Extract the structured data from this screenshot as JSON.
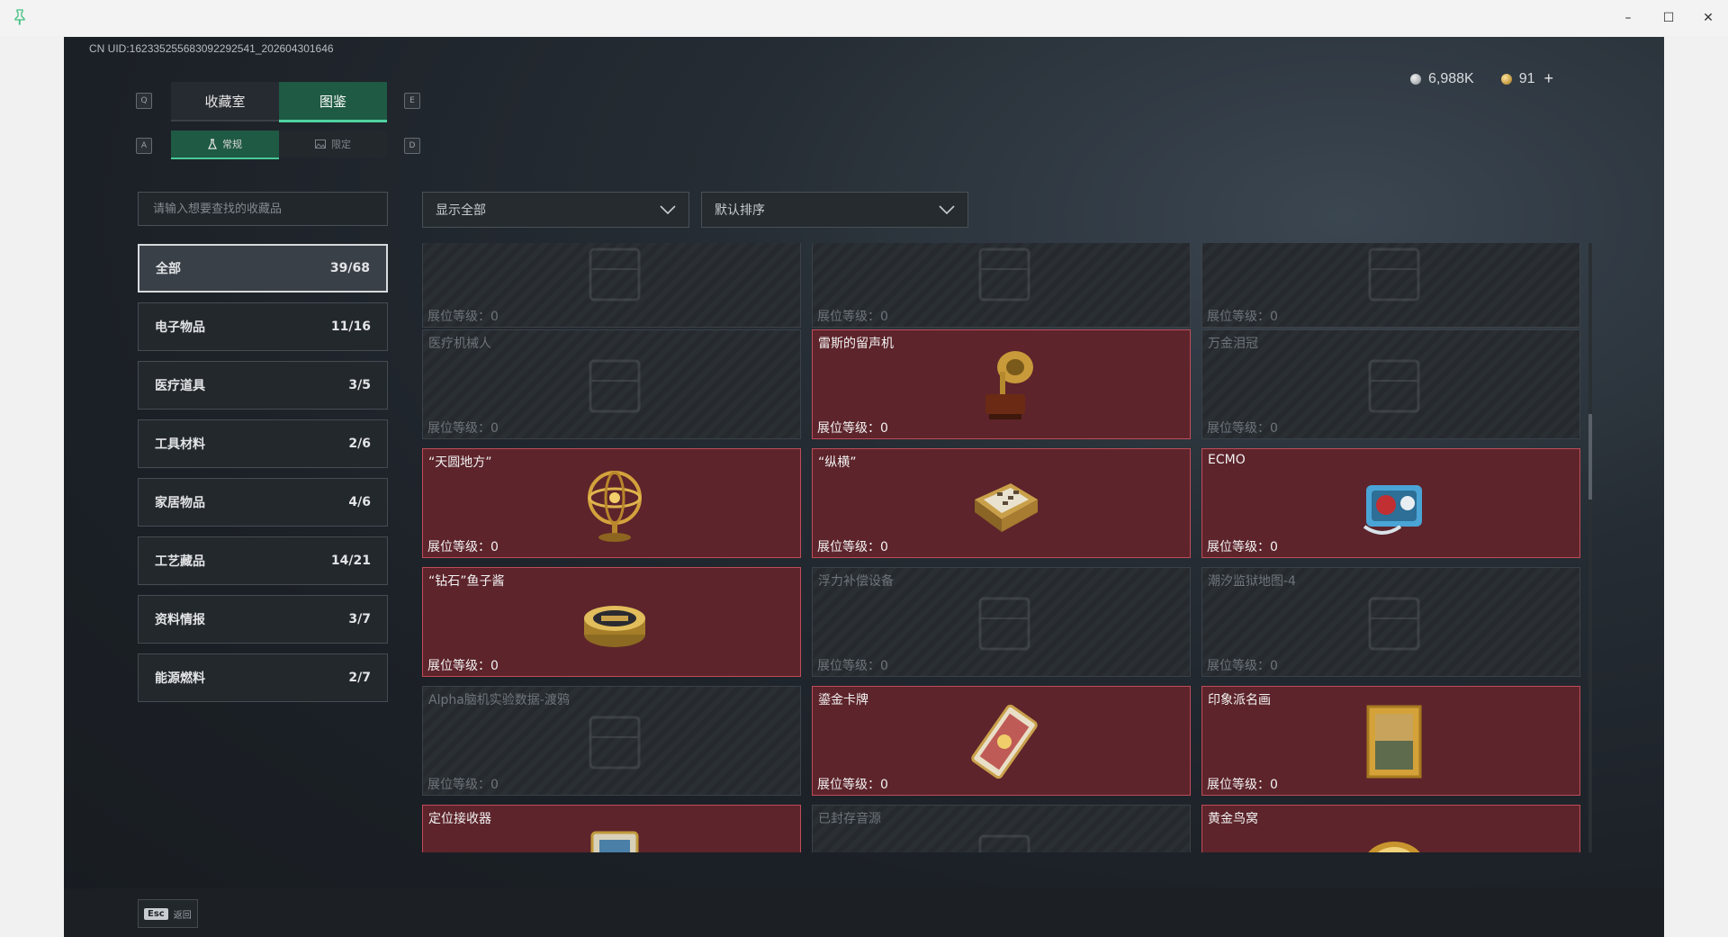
{
  "window": {
    "minimize": "–",
    "maximize": "☐",
    "close": "✕"
  },
  "uid_text": "CN UID:1623352556830922925​41_202604301646",
  "currency": {
    "silver": "6,988K",
    "gold": "91",
    "plus": "+"
  },
  "tabs": {
    "key_left": "Q",
    "key_right": "E",
    "items": [
      {
        "label": "收藏室"
      },
      {
        "label": "图鉴"
      }
    ]
  },
  "subtabs": {
    "key_left": "A",
    "key_right": "D",
    "items": [
      {
        "label": "常规"
      },
      {
        "label": "限定"
      }
    ]
  },
  "search": {
    "placeholder": "请输入想要查找的收藏品"
  },
  "categories": [
    {
      "label": "全部",
      "count": "39/68"
    },
    {
      "label": "电子物品",
      "count": "11/16"
    },
    {
      "label": "医疗道具",
      "count": "3/5"
    },
    {
      "label": "工具材料",
      "count": "2/6"
    },
    {
      "label": "家居物品",
      "count": "4/6"
    },
    {
      "label": "工艺藏品",
      "count": "14/21"
    },
    {
      "label": "资料情报",
      "count": "3/7"
    },
    {
      "label": "能源燃料",
      "count": "2/7"
    }
  ],
  "filters": {
    "show": "显示全部",
    "sort": "默认排序"
  },
  "cards": [
    {
      "name": "",
      "level": "展位等级：0",
      "owned": false,
      "icon": "machine-icon"
    },
    {
      "name": "",
      "level": "展位等级：0",
      "owned": false,
      "icon": "box-icon"
    },
    {
      "name": "",
      "level": "展位等级：0",
      "owned": false,
      "icon": "box-icon"
    },
    {
      "name": "医疗机械人",
      "level": "展位等级：0",
      "owned": false,
      "icon": "robot-icon"
    },
    {
      "name": "雷斯的留声机",
      "level": "展位等级：0",
      "owned": true,
      "icon": "gramophone-icon"
    },
    {
      "name": "万金泪冠",
      "level": "展位等级：0",
      "owned": false,
      "icon": "crown-icon"
    },
    {
      "name": "“天圆地方”",
      "level": "展位等级：0",
      "owned": true,
      "icon": "armillary-sphere-icon"
    },
    {
      "name": "“纵横”",
      "level": "展位等级：0",
      "owned": true,
      "icon": "chess-board-icon"
    },
    {
      "name": "ECMO",
      "level": "展位等级：0",
      "owned": true,
      "icon": "ecmo-machine-icon"
    },
    {
      "name": "“钻石”鱼子酱",
      "level": "展位等级：0",
      "owned": true,
      "icon": "caviar-tin-icon"
    },
    {
      "name": "浮力补偿设备",
      "level": "展位等级：0",
      "owned": false,
      "icon": "vest-icon"
    },
    {
      "name": "潮汐监狱地图-4",
      "level": "展位等级：0",
      "owned": false,
      "icon": "map-icon"
    },
    {
      "name": "Alpha脑机实验数据-渡鸦",
      "level": "展位等级：0",
      "owned": false,
      "icon": "drive-icon"
    },
    {
      "name": "鎏金卡牌",
      "level": "展位等级：0",
      "owned": true,
      "icon": "gilded-card-icon"
    },
    {
      "name": "印象派名画",
      "level": "展位等级：0",
      "owned": true,
      "icon": "painting-icon"
    },
    {
      "name": "定位接收器",
      "level": "",
      "owned": true,
      "icon": "receiver-icon"
    },
    {
      "name": "已封存音源",
      "level": "",
      "owned": false,
      "icon": "audio-icon"
    },
    {
      "name": "黄金鸟窝",
      "level": "",
      "owned": true,
      "icon": "golden-nest-icon"
    }
  ],
  "footer": {
    "esc_key": "Esc",
    "esc_label": "返回"
  }
}
